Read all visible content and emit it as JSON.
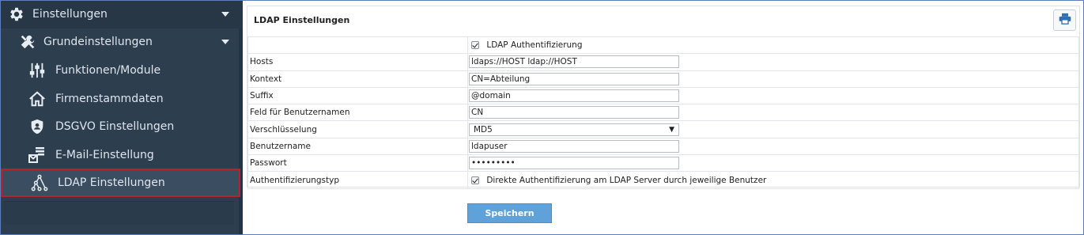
{
  "sidebar": {
    "items": [
      {
        "label": "Einstellungen",
        "icon": "gear-icon"
      },
      {
        "label": "Grundeinstellungen",
        "icon": "tools-icon"
      },
      {
        "label": "Funktionen/Module",
        "icon": "sliders-icon"
      },
      {
        "label": "Firmenstammdaten",
        "icon": "home-icon"
      },
      {
        "label": "DSGVO Einstellungen",
        "icon": "shield-icon"
      },
      {
        "label": "E-Mail-Einstellung",
        "icon": "mail-icon"
      },
      {
        "label": "LDAP Einstellungen",
        "icon": "network-icon"
      }
    ]
  },
  "panel": {
    "title": "LDAP Einstellungen",
    "print_icon": "printer-icon"
  },
  "form": {
    "ldap_auth_label": "LDAP Authentifizierung",
    "rows": [
      {
        "label": "Hosts",
        "value": "ldaps://HOST ldap://HOST"
      },
      {
        "label": "Kontext",
        "value": "CN=Abteilung"
      },
      {
        "label": "Suffix",
        "value": "@domain"
      },
      {
        "label": "Feld für Benutzernamen",
        "value": "CN"
      },
      {
        "label": "Verschlüsselung",
        "value": "MD5"
      },
      {
        "label": "Benutzername",
        "value": "ldapuser"
      },
      {
        "label": "Passwort",
        "value": "•••••••••"
      },
      {
        "label": "Authentifizierungstyp",
        "value": "Direkte Authentifizierung am LDAP Server durch jeweilige Benutzer"
      }
    ]
  },
  "save_label": "Speichern",
  "colors": {
    "sidebar_bg": "#2d3e4f",
    "active_border": "#b8222c",
    "button_bg": "#5fa2d9"
  }
}
